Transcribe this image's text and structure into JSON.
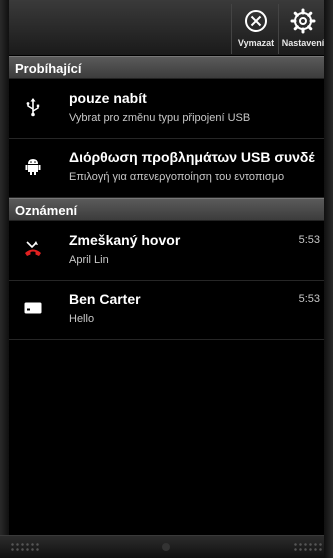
{
  "topbar": {
    "clear_label": "Vymazat",
    "settings_label": "Nastavení"
  },
  "sections": {
    "ongoing": "Probíhající",
    "notifications": "Oznámení"
  },
  "ongoing_items": [
    {
      "title": "pouze nabít",
      "subtitle": "Vybrat pro změnu typu připojení USB",
      "icon": "usb-icon"
    },
    {
      "title": "Διόρθωση προβλημάτων USB συνδέ",
      "subtitle": "Επιλογή για απενεργοποίηση του εντοπισμο",
      "icon": "android-debug-icon"
    }
  ],
  "notification_items": [
    {
      "title": "Zmeškaný hovor",
      "subtitle": "April Lin",
      "time": "5:53",
      "icon": "missed-call-icon",
      "icon_color": "#e02020"
    },
    {
      "title": "Ben Carter",
      "subtitle": "Hello",
      "time": "5:53",
      "icon": "message-icon"
    }
  ]
}
